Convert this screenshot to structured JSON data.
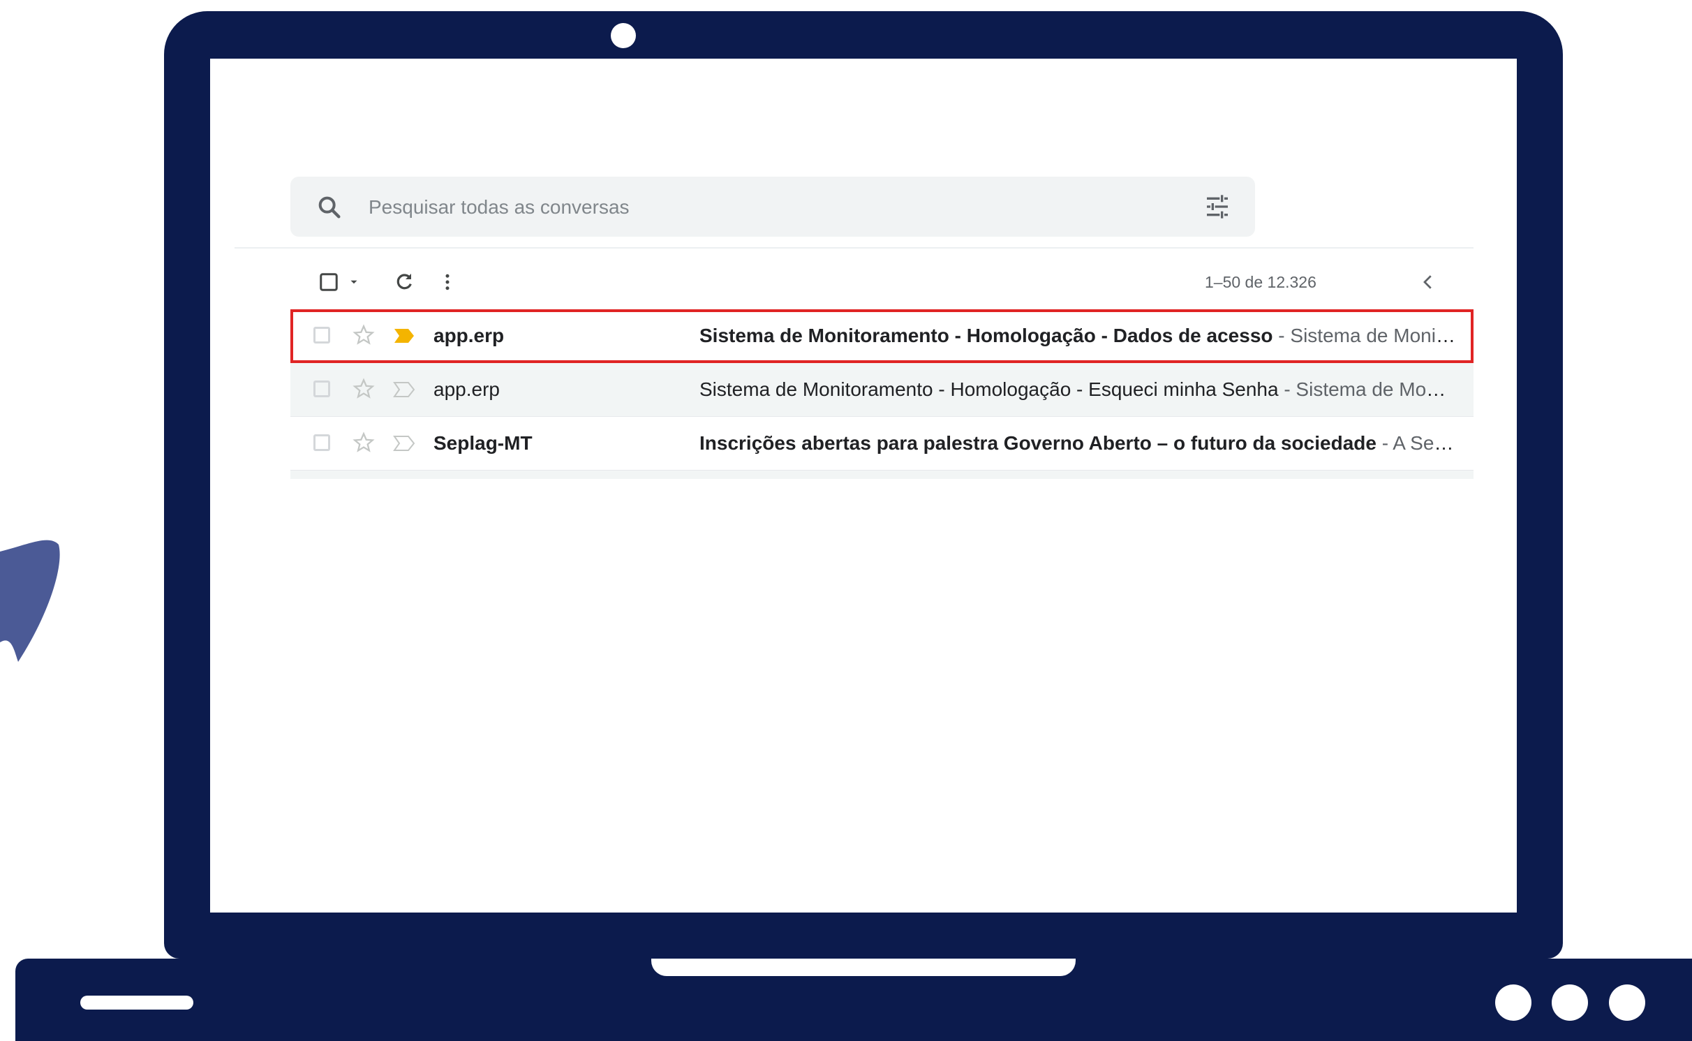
{
  "colors": {
    "laptop_frame": "#0c1b4d",
    "deco_shape": "#4b5a96",
    "highlight": "#e02424",
    "important_marker": "#f4b400"
  },
  "search": {
    "placeholder": "Pesquisar todas as conversas",
    "icon": "search-icon",
    "options_icon": "tune-icon"
  },
  "toolbar": {
    "select_icon": "checkbox-icon",
    "select_menu_icon": "caret-down-icon",
    "refresh_icon": "refresh-icon",
    "more_icon": "more-vert-icon",
    "pagination": "1–50 de 12.326",
    "prev_icon": "chevron-left-icon"
  },
  "messages": [
    {
      "sender": "app.erp",
      "subject": "Sistema de Monitoramento - Homologação - Dados de acesso",
      "snippet": " - Sistema de Monitoramento",
      "unread": true,
      "important": true,
      "highlighted": true
    },
    {
      "sender": "app.erp",
      "subject": "Sistema de Monitoramento - Homologação - Esqueci minha Senha",
      "snippet": " - Sistema de Monitoramento",
      "unread": false,
      "important": false,
      "highlighted": false
    },
    {
      "sender": "Seplag-MT",
      "subject": "Inscrições abertas para palestra Governo Aberto – o futuro da sociedade",
      "snippet": " - A Secretaria",
      "unread": true,
      "important": false,
      "highlighted": false
    }
  ]
}
